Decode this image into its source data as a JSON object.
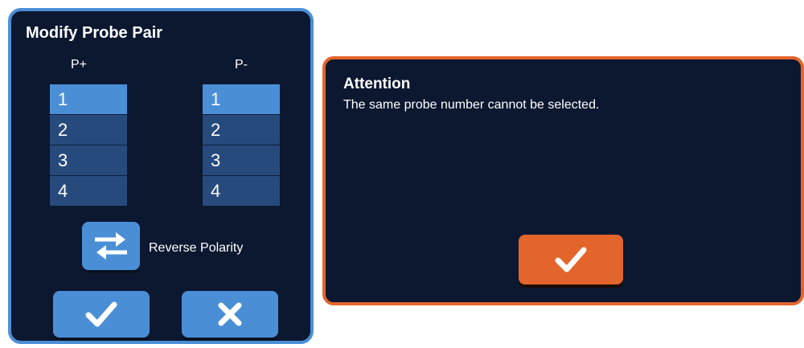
{
  "probe_dialog": {
    "title": "Modify Probe Pair",
    "p_plus": {
      "header": "P+",
      "items": [
        "1",
        "2",
        "3",
        "4"
      ],
      "selected": "1"
    },
    "p_minus": {
      "header": "P-",
      "items": [
        "1",
        "2",
        "3",
        "4"
      ],
      "selected": "1"
    },
    "reverse_label": "Reverse Polarity",
    "reverse_icon": "swap-arrows-icon",
    "confirm_icon": "checkmark-icon",
    "cancel_icon": "close-icon"
  },
  "attention_dialog": {
    "title": "Attention",
    "message": "The same probe number cannot be selected.",
    "ok_icon": "checkmark-icon"
  },
  "colors": {
    "panel_background": "#0c1730",
    "accent_blue": "#4a8fd6",
    "list_item_blue": "#274a7c",
    "accent_orange": "#e3652b",
    "text": "#ffffff"
  }
}
